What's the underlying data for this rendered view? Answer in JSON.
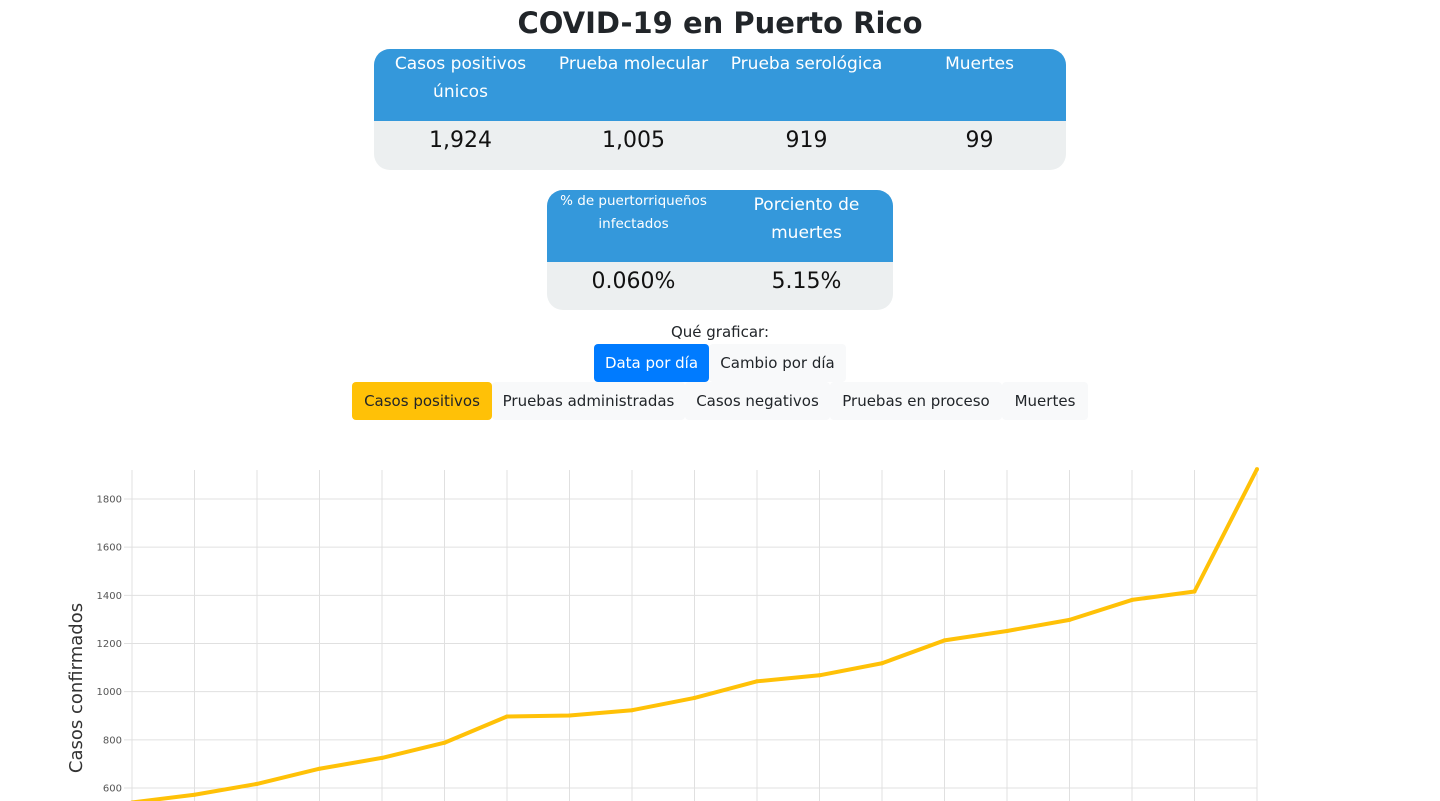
{
  "page": {
    "title": "COVID-19 en Puerto Rico"
  },
  "summary": {
    "headers": [
      "Casos positivos únicos",
      "Prueba molecular",
      "Prueba serológica",
      "Muertes"
    ],
    "values": [
      "1,924",
      "1,005",
      "919",
      "99"
    ]
  },
  "rates": {
    "headers": [
      "% de puertorriqueños infectados",
      "Porciento de muertes"
    ],
    "values": [
      "0.060%",
      "5.15%"
    ]
  },
  "controls": {
    "prompt": "Qué graficar:",
    "mode_buttons": [
      {
        "label": "Data por día",
        "active": true
      },
      {
        "label": "Cambio por día",
        "active": false
      }
    ],
    "metric_buttons": [
      {
        "label": "Casos positivos",
        "active": true
      },
      {
        "label": "Pruebas administradas",
        "active": false
      },
      {
        "label": "Casos negativos",
        "active": false
      },
      {
        "label": "Pruebas en proceso",
        "active": false
      },
      {
        "label": "Muertes",
        "active": false
      }
    ]
  },
  "colors": {
    "header_blue": "#3498db",
    "table_body": "#eceff0",
    "active_blue": "#007bff",
    "active_yellow": "#ffc107",
    "line": "#ffc107",
    "grid": "#e0e0e0"
  },
  "chart_data": {
    "type": "line",
    "ylabel": "Casos confirmados",
    "ylim_visible": [
      590,
      1924
    ],
    "yticks": [
      600,
      800,
      1000,
      1200,
      1400,
      1600,
      1800
    ],
    "grid": true,
    "series": [
      {
        "values": [
          540,
          572,
          617,
          680,
          725,
          788,
          897,
          901,
          923,
          974,
          1043,
          1068,
          1118,
          1213,
          1252,
          1298,
          1381,
          1416,
          1924
        ]
      }
    ]
  }
}
